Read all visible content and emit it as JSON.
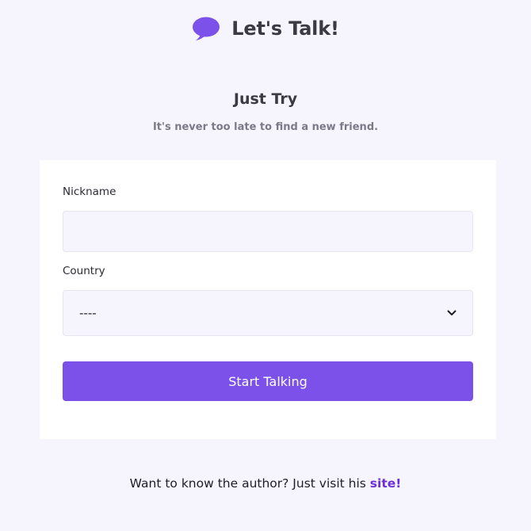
{
  "header": {
    "logo_icon": "chat-bubble-icon",
    "title": "Let's Talk!",
    "accent_color": "#7b51ea"
  },
  "intro": {
    "heading": "Just Try",
    "subheading": "It's never too late to find a new friend."
  },
  "form": {
    "nickname_label": "Nickname",
    "nickname_value": "",
    "nickname_placeholder": "",
    "country_label": "Country",
    "country_selected": "----",
    "country_icon": "chevron-down-icon",
    "submit_label": "Start Talking"
  },
  "footer": {
    "text": "Want to know the author? Just visit his ",
    "link_text": "site!",
    "link_color": "#6a2fd6"
  }
}
